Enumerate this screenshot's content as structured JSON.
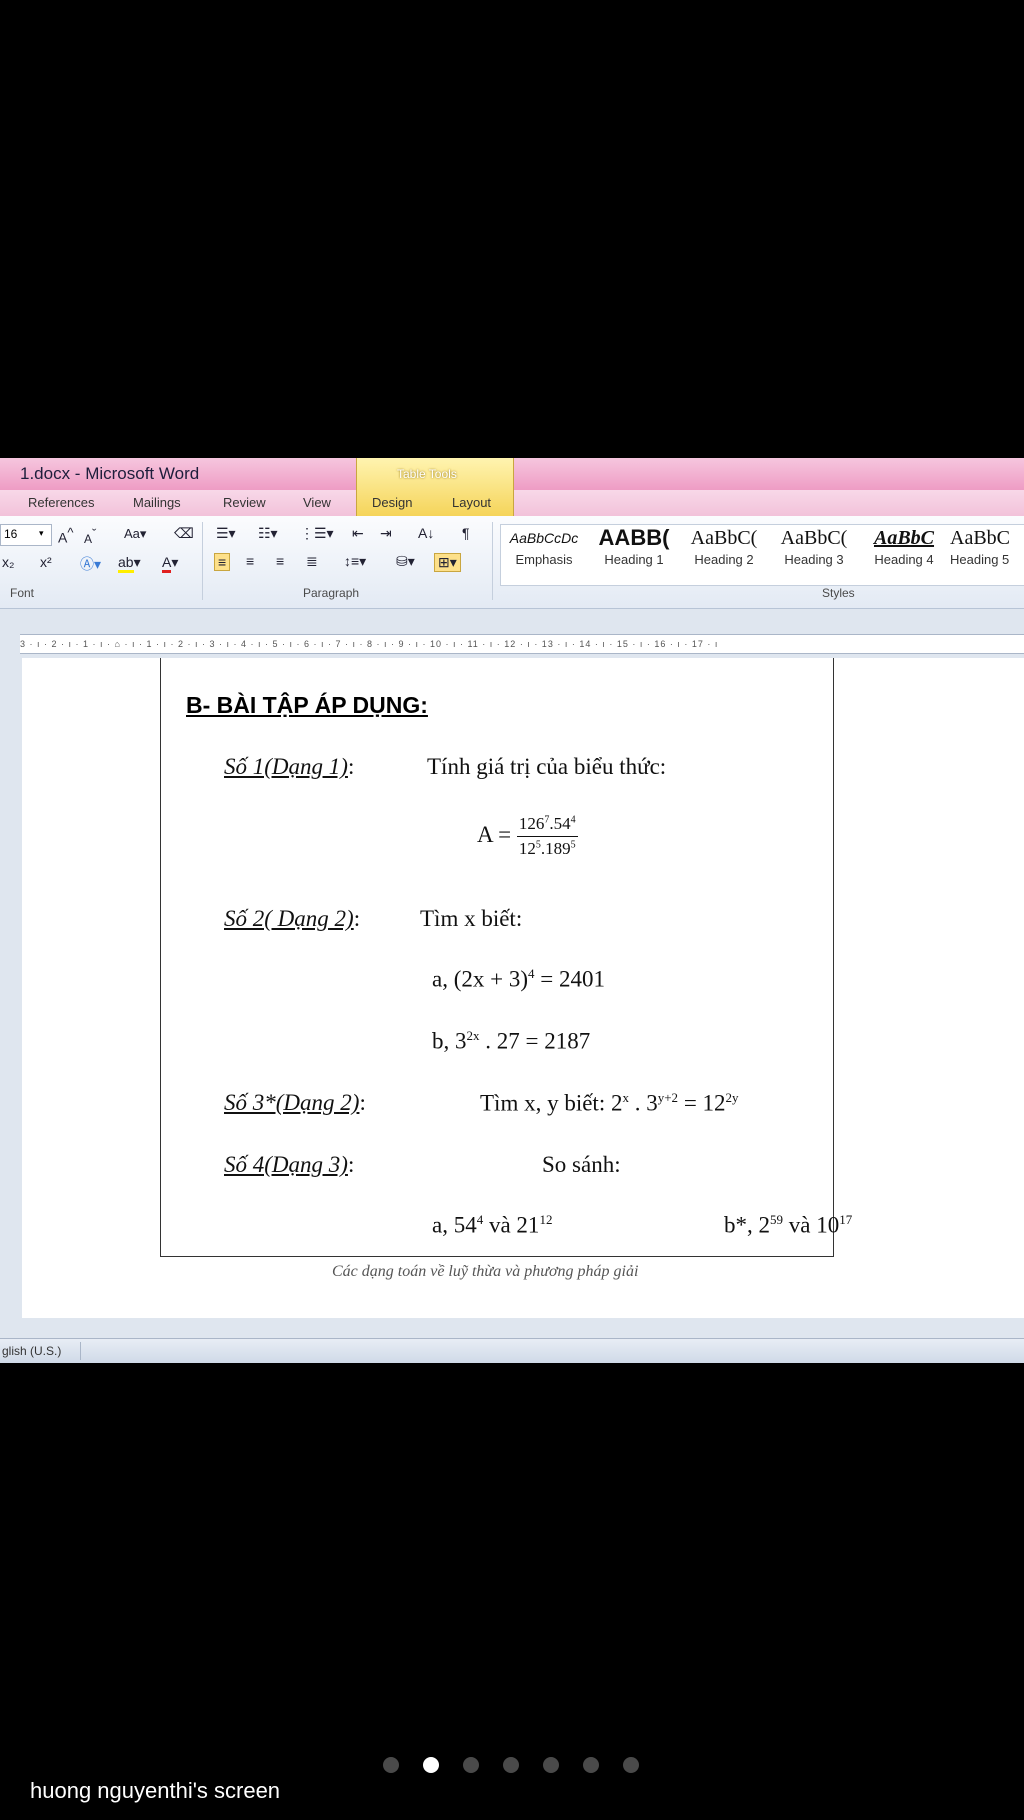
{
  "window": {
    "title": "1.docx - Microsoft Word",
    "context_tab_group": "Table Tools",
    "tabs": [
      "References",
      "Mailings",
      "Review",
      "View",
      "Design",
      "Layout"
    ]
  },
  "ribbon": {
    "font_size": "16",
    "groups": {
      "font": "Font",
      "paragraph": "Paragraph",
      "styles": "Styles"
    },
    "styles": [
      {
        "sample": "AaBbCcDc",
        "name": "Emphasis"
      },
      {
        "sample": "AABB(",
        "name": "Heading 1"
      },
      {
        "sample": "AaBbC(",
        "name": "Heading 2"
      },
      {
        "sample": "AaBbC(",
        "name": "Heading 3"
      },
      {
        "sample": "AaBbC",
        "name": "Heading 4"
      },
      {
        "sample": "AaBbC",
        "name": "Heading 5"
      }
    ]
  },
  "ruler": {
    "text": "3 · ı · 2 · ı · 1 · ı · ⌂ · ı · 1 · ı · 2 · ı · 3 · ı · 4 · ı · 5 · ı · 6 · ı · 7 · ı · 8 · ı · 9 · ı · 10 · ı · 11 · ı · 12 · ı · 13 · ı · 14 · ı · 15 · ı · 16 · ı · 17 · ı"
  },
  "document": {
    "heading": "B- BÀI TẬP ÁP DỤNG:",
    "ex1": {
      "label": "Số 1(Dạng 1)",
      "colon": ":",
      "text": "Tính giá trị của biểu thức:"
    },
    "formula": {
      "lhs": "A =",
      "num_a": "126",
      "num_a_exp": "7",
      "num_b": ".54",
      "num_b_exp": "4",
      "den_a": "12",
      "den_a_exp": "5",
      "den_b": ".189",
      "den_b_exp": "5"
    },
    "ex2": {
      "label": "Số 2( Dạng 2)",
      "colon": ":",
      "text": "Tìm x biết:"
    },
    "ex2a": {
      "pre": "a, (2x + 3)",
      "exp": "4",
      "post": " = 2401"
    },
    "ex2b": {
      "pre": "b, 3",
      "exp": "2x",
      "post": " . 27 = 2187"
    },
    "ex3": {
      "label": "Số 3*(Dạng 2)",
      "colon": ":",
      "pre": "Tìm x, y biết: 2",
      "exp1": "x",
      "mid": " . 3",
      "exp2": "y+2",
      "mid2": " = 12",
      "exp3": "2y"
    },
    "ex4": {
      "label": "Số 4(Dạng 3)",
      "colon": ":",
      "text": "So sánh:"
    },
    "ex4a": {
      "pre": "a, 54",
      "exp1": "4",
      "mid": " và 21",
      "exp2": "12"
    },
    "ex4b": {
      "pre": "b*, 2",
      "exp1": "59",
      "mid": " và 10",
      "exp2": "17"
    },
    "footer": "Các dạng toán về luỹ thừa và phương pháp giải"
  },
  "statusbar": {
    "language": "glish (U.S.)"
  },
  "share": {
    "label": "huong nguyenthi's screen",
    "page_count": 7,
    "active_page": 2
  },
  "colors": {
    "title_bar": "#ee9cc4",
    "context_tab": "#f5d45a",
    "background": "#000000"
  }
}
